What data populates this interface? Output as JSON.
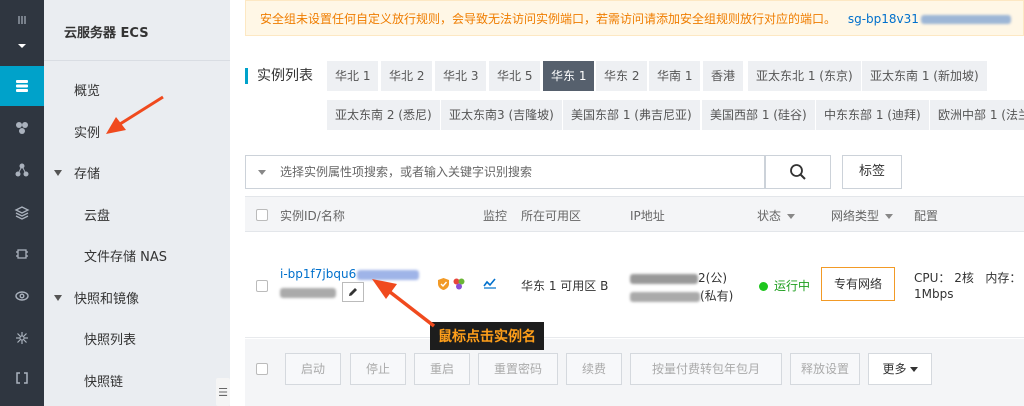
{
  "subnav": {
    "title": "云服务器 ECS",
    "items": [
      "概览",
      "实例"
    ],
    "storage_group": "存储",
    "storage_children": [
      "云盘",
      "文件存储 NAS"
    ],
    "snapshot_group": "快照和镜像",
    "snapshot_children": [
      "快照列表",
      "快照链"
    ]
  },
  "banner": {
    "text": "安全组未设置任何自定义放行规则，会导致无法访问实例端口，若需访问请添加安全组规则放行对应的端口。",
    "sg_id": "sg-bp18v31"
  },
  "list_title": "实例列表",
  "regions_row1": [
    "华北 1",
    "华北 2",
    "华北 3",
    "华北 5",
    "华东 1",
    "华东 2",
    "华南 1",
    "香港",
    "亚太东北 1 (东京)",
    "亚太东南 1 (新加坡)"
  ],
  "regions_row2": [
    "亚太东南 2 (悉尼)",
    "亚太东南3 (吉隆坡)",
    "美国东部 1 (弗吉尼亚)",
    "美国西部 1 (硅谷)",
    "中东东部 1 (迪拜)",
    "欧洲中部 1 (法兰"
  ],
  "selected_region": "华东 1",
  "search": {
    "placeholder": "选择实例属性项搜索，或者输入关键字识别搜索"
  },
  "tag_button": "标签",
  "columns": {
    "id_name": "实例ID/名称",
    "monitor": "监控",
    "zone": "所在可用区",
    "ip": "IP地址",
    "status": "状态",
    "network": "网络类型",
    "config": "配置"
  },
  "instance": {
    "id_prefix": "i-bp1f7jbqu6",
    "zone": "华东 1 可用区 B",
    "ip_public_suffix": "2(公)",
    "ip_private_suffix": "(私有)",
    "status": "运行中",
    "network": "专有网络",
    "cpu": "CPU：  2核",
    "memory": "内存：",
    "bandwidth": "1Mbps"
  },
  "actions": [
    "启动",
    "停止",
    "重启",
    "重置密码",
    "续费",
    "按量付费转包年包月",
    "释放设置",
    "更多"
  ],
  "annotation": "鼠标点击实例名",
  "colors": {
    "accent": "#00a2ca",
    "warning": "#ef7d00",
    "link": "#0070cc",
    "arrow": "#f04a1e",
    "running": "#1ec61e"
  }
}
